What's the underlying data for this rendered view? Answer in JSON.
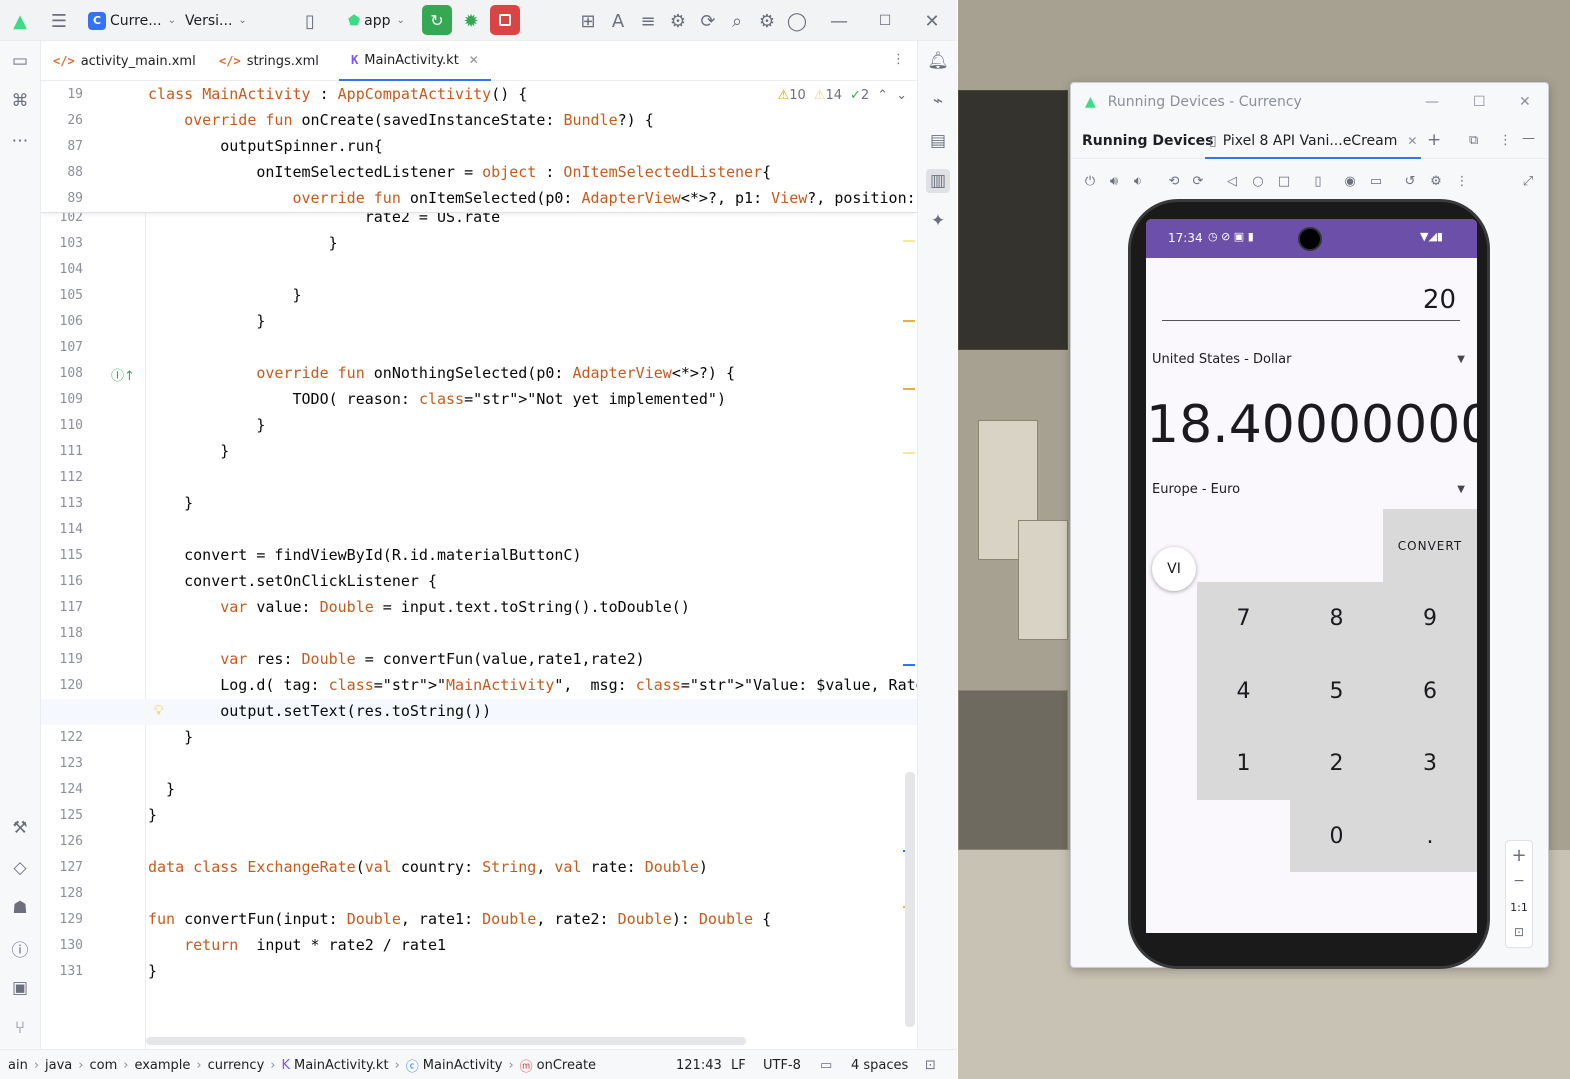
{
  "titlebar": {
    "project": "Curre...",
    "project_badge": "C",
    "vcs": "Versi...",
    "run_config": "app"
  },
  "tabs": [
    {
      "label": "activity_main.xml",
      "icon": "xml-file-icon"
    },
    {
      "label": "strings.xml",
      "icon": "xml-file-icon"
    },
    {
      "label": "MainActivity.kt",
      "icon": "kotlin-file-icon",
      "active": true
    }
  ],
  "inspections": {
    "warnings": "10",
    "weak_warnings": "14",
    "typos": "2"
  },
  "sticky_lines": [
    {
      "n": "19",
      "text": "class MainActivity : AppCompatActivity() {"
    },
    {
      "n": "26",
      "text": "    override fun onCreate(savedInstanceState: Bundle?) {"
    },
    {
      "n": "87",
      "text": "        outputSpinner.run{"
    },
    {
      "n": "88",
      "text": "            onItemSelectedListener = object : OnItemSelectedListener{"
    },
    {
      "n": "89",
      "text": "                override fun onItemSelected(p0: AdapterView<*>?, p1: View?, position:"
    }
  ],
  "code_lines": [
    {
      "n": "102",
      "text": "                        rate2 = US.rate"
    },
    {
      "n": "103",
      "text": "                    }"
    },
    {
      "n": "104",
      "text": ""
    },
    {
      "n": "105",
      "text": "                }"
    },
    {
      "n": "106",
      "text": "            }"
    },
    {
      "n": "107",
      "text": ""
    },
    {
      "n": "108",
      "text": "            override fun onNothingSelected(p0: AdapterView<*>?) {"
    },
    {
      "n": "109",
      "text": "                TODO( reason: \"Not yet implemented\")"
    },
    {
      "n": "110",
      "text": "            }"
    },
    {
      "n": "111",
      "text": "        }"
    },
    {
      "n": "112",
      "text": ""
    },
    {
      "n": "113",
      "text": "    }"
    },
    {
      "n": "114",
      "text": ""
    },
    {
      "n": "115",
      "text": "    convert = findViewById(R.id.materialButtonC)"
    },
    {
      "n": "116",
      "text": "    convert.setOnClickListener {"
    },
    {
      "n": "117",
      "text": "        var value: Double = input.text.toString().toDouble()"
    },
    {
      "n": "118",
      "text": ""
    },
    {
      "n": "119",
      "text": "        var res: Double = convertFun(value,rate1,rate2)"
    },
    {
      "n": "120",
      "text": "        Log.d( tag: \"MainActivity\",  msg: \"Value: $value, Rate1: $rate1, Rate2: $rat"
    },
    {
      "n": "121",
      "text": "        output.setText(res.toString())"
    },
    {
      "n": "122",
      "text": "    }"
    },
    {
      "n": "123",
      "text": ""
    },
    {
      "n": "124",
      "text": "  }"
    },
    {
      "n": "125",
      "text": "}"
    },
    {
      "n": "126",
      "text": ""
    },
    {
      "n": "127",
      "text": "data class ExchangeRate(val country: String, val rate: Double)"
    },
    {
      "n": "128",
      "text": ""
    },
    {
      "n": "129",
      "text": "fun convertFun(input: Double, rate1: Double, rate2: Double): Double {"
    },
    {
      "n": "130",
      "text": "    return  input * rate2 / rate1"
    },
    {
      "n": "131",
      "text": "}"
    }
  ],
  "statusbar": {
    "path": [
      "ain",
      "java",
      "com",
      "example",
      "currency",
      "MainActivity.kt",
      "MainActivity",
      "onCreate"
    ],
    "position": "121:43",
    "line_sep": "LF",
    "encoding": "UTF-8",
    "indent": "4 spaces"
  },
  "running_devices": {
    "window_title": "Running Devices - Currency",
    "panel_label": "Running Devices",
    "device_tab": "Pixel 8 API Vani...eCream",
    "zoom_label": "1:1"
  },
  "phone": {
    "time": "17:34",
    "amount": "20",
    "from_currency": "United States - Dollar",
    "result": "18.40000000",
    "to_currency": "Europe - Euro",
    "convert_label": "CONVERT",
    "fab_label": "VI",
    "keys": [
      "7",
      "8",
      "9",
      "4",
      "5",
      "6",
      "1",
      "2",
      "3",
      "0",
      "."
    ]
  },
  "colors": {
    "accent": "#3574f0",
    "keyword": "#0033b3",
    "kotlin_keyword": "#c75a1c",
    "phone_statusbar": "#6b4fa8",
    "run_green": "#34a853",
    "stop_red": "#d94545"
  }
}
